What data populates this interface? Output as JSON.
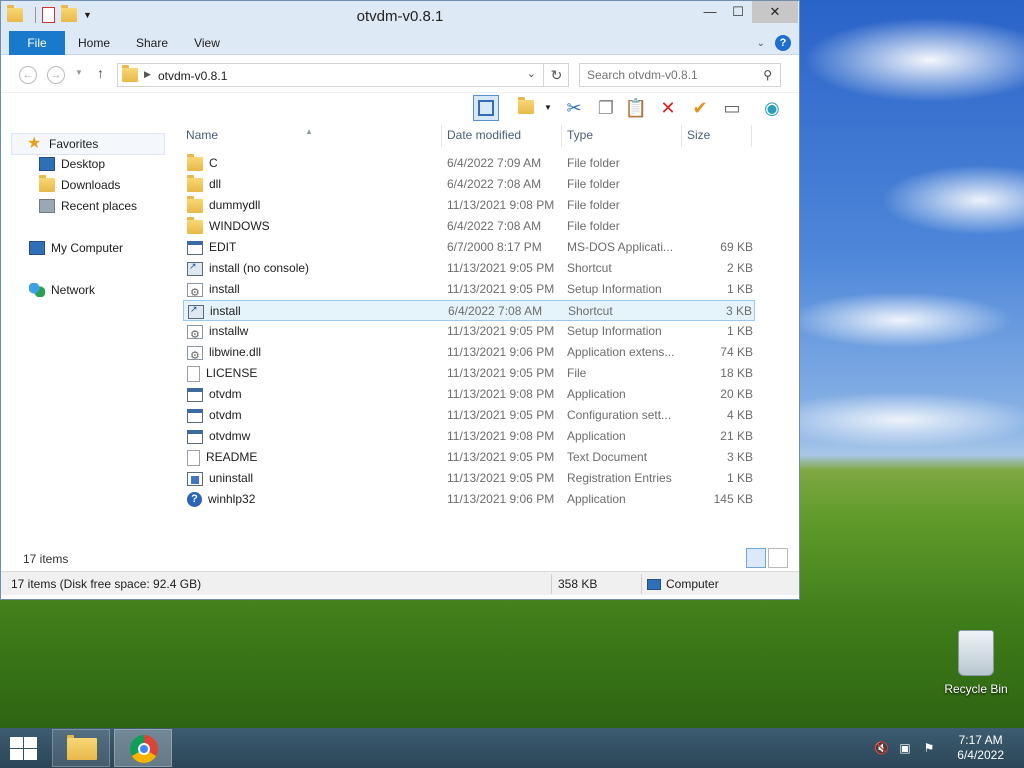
{
  "window": {
    "title": "otvdm-v0.8.1",
    "minimize": "—",
    "maximize": "☐",
    "close": "✕"
  },
  "ribbon": {
    "tabs": [
      "File",
      "Home",
      "Share",
      "View"
    ]
  },
  "address": {
    "crumb": "otvdm-v0.8.1",
    "search_placeholder": "Search otvdm-v0.8.1"
  },
  "nav_pane": {
    "favorites": "Favorites",
    "favorites_items": [
      "Desktop",
      "Downloads",
      "Recent places"
    ],
    "computer": "My Computer",
    "network": "Network"
  },
  "columns": {
    "name": "Name",
    "date": "Date modified",
    "type": "Type",
    "size": "Size"
  },
  "files": [
    {
      "name": "C",
      "date": "6/4/2022 7:09 AM",
      "type": "File folder",
      "size": "",
      "icon": "folder-icon"
    },
    {
      "name": "dll",
      "date": "6/4/2022 7:08 AM",
      "type": "File folder",
      "size": "",
      "icon": "folder-icon"
    },
    {
      "name": "dummydll",
      "date": "11/13/2021 9:08 PM",
      "type": "File folder",
      "size": "",
      "icon": "folder-icon"
    },
    {
      "name": "WINDOWS",
      "date": "6/4/2022 7:08 AM",
      "type": "File folder",
      "size": "",
      "icon": "folder-icon"
    },
    {
      "name": "EDIT",
      "date": "6/7/2000 8:17 PM",
      "type": "MS-DOS Applicati...",
      "size": "69 KB",
      "icon": "app-icon"
    },
    {
      "name": "install (no console)",
      "date": "11/13/2021 9:05 PM",
      "type": "Shortcut",
      "size": "2 KB",
      "icon": "shortcut-icon"
    },
    {
      "name": "install",
      "date": "11/13/2021 9:05 PM",
      "type": "Setup Information",
      "size": "1 KB",
      "icon": "setup-info-icon"
    },
    {
      "name": "install",
      "date": "6/4/2022 7:08 AM",
      "type": "Shortcut",
      "size": "3 KB",
      "icon": "shortcut-icon"
    },
    {
      "name": "installw",
      "date": "11/13/2021 9:05 PM",
      "type": "Setup Information",
      "size": "1 KB",
      "icon": "setup-info-icon"
    },
    {
      "name": "libwine.dll",
      "date": "11/13/2021 9:06 PM",
      "type": "Application extens...",
      "size": "74 KB",
      "icon": "dll-icon"
    },
    {
      "name": "LICENSE",
      "date": "11/13/2021 9:05 PM",
      "type": "File",
      "size": "18 KB",
      "icon": "file-icon"
    },
    {
      "name": "otvdm",
      "date": "11/13/2021 9:08 PM",
      "type": "Application",
      "size": "20 KB",
      "icon": "app-icon"
    },
    {
      "name": "otvdm",
      "date": "11/13/2021 9:05 PM",
      "type": "Configuration sett...",
      "size": "4 KB",
      "icon": "config-icon"
    },
    {
      "name": "otvdmw",
      "date": "11/13/2021 9:08 PM",
      "type": "Application",
      "size": "21 KB",
      "icon": "app-icon"
    },
    {
      "name": "README",
      "date": "11/13/2021 9:05 PM",
      "type": "Text Document",
      "size": "3 KB",
      "icon": "text-doc-icon"
    },
    {
      "name": "uninstall",
      "date": "11/13/2021 9:05 PM",
      "type": "Registration Entries",
      "size": "1 KB",
      "icon": "registry-icon"
    },
    {
      "name": "winhlp32",
      "date": "11/13/2021 9:06 PM",
      "type": "Application",
      "size": "145 KB",
      "icon": "help-app-icon"
    }
  ],
  "selected_index": 7,
  "item_count": "17 items",
  "status": {
    "left": "17 items (Disk free space: 92.4 GB)",
    "size": "358 KB",
    "location": "Computer"
  },
  "desktop": {
    "recycle_bin": "Recycle Bin"
  },
  "taskbar": {
    "time": "7:17 AM",
    "date": "6/4/2022"
  },
  "colors": {
    "accent": "#1979ca",
    "selection": "#e5f3fb",
    "titlebar": "#dde9f5"
  }
}
